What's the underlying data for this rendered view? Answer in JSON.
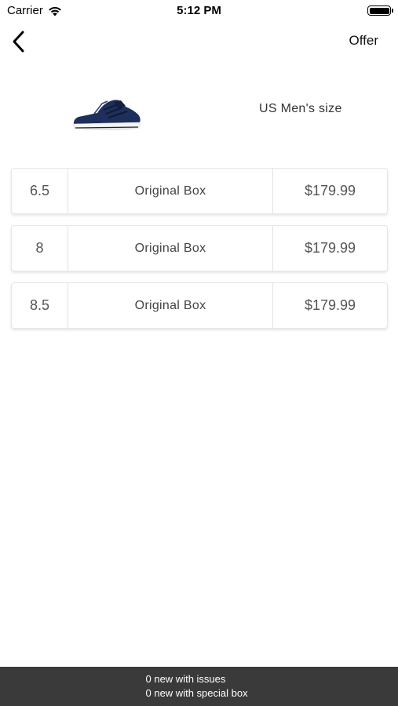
{
  "status_bar": {
    "carrier": "Carrier",
    "time": "5:12 PM"
  },
  "nav": {
    "back_icon": "chevron-left-icon",
    "offer_label": "Offer"
  },
  "product": {
    "image_icon": "sneaker-image",
    "size_label": "US Men's size"
  },
  "rows": [
    {
      "size": "6.5",
      "box": "Original Box",
      "price": "$179.99"
    },
    {
      "size": "8",
      "box": "Original Box",
      "price": "$179.99"
    },
    {
      "size": "8.5",
      "box": "Original Box",
      "price": "$179.99"
    }
  ],
  "footer": {
    "line1": "0 new with issues",
    "line2": "0 new with special box"
  },
  "colors": {
    "footer_bg": "#3a3a3a",
    "shoe_blue": "#1f2f5c"
  }
}
